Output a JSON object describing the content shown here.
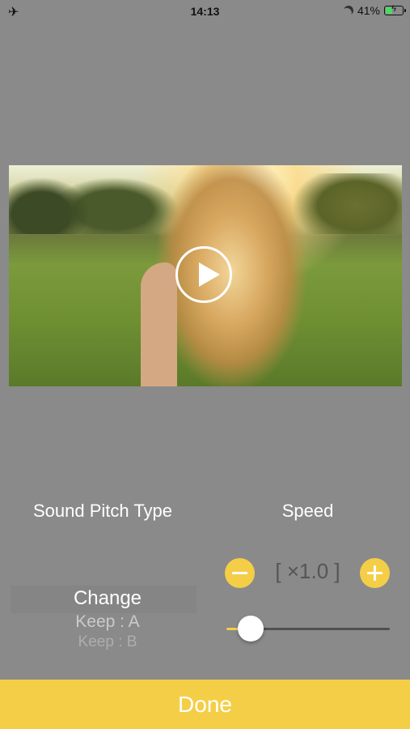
{
  "status_bar": {
    "airplane_icon": "airplane-icon",
    "time": "14:13",
    "battery_percent": "41%",
    "battery_level": 0.41,
    "moon_icon": "moon-icon",
    "battery_icon": "battery-charging-icon"
  },
  "video": {
    "play_icon": "play-icon"
  },
  "pitch": {
    "title": "Sound Pitch Type",
    "options": [
      "Change",
      "Keep : A",
      "Keep : B"
    ],
    "selected": "Change"
  },
  "speed": {
    "title": "Speed",
    "value": "[ ×1.0 ]",
    "slider_level": 0.15,
    "accent_color": "#f5ce47"
  },
  "done_label": "Done"
}
